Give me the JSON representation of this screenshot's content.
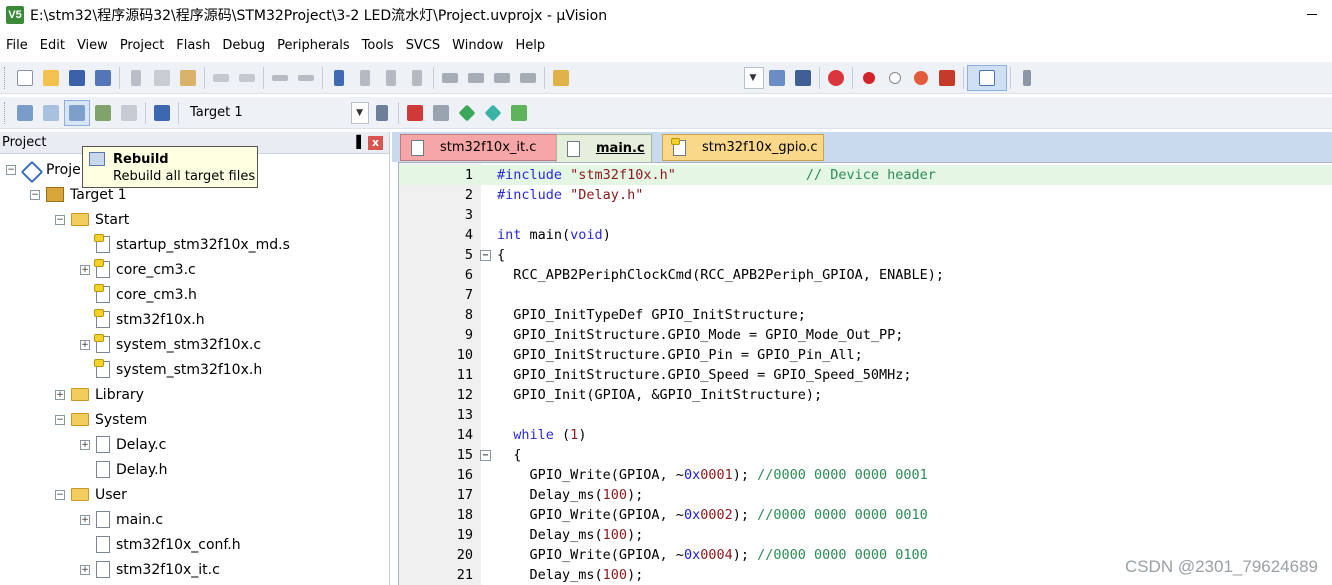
{
  "window": {
    "app_icon_text": "V5",
    "title": "E:\\stm32\\程序源码32\\程序源码\\STM32Project\\3-2 LED流水灯\\Project.uvprojx - µVision"
  },
  "menu": [
    "File",
    "Edit",
    "View",
    "Project",
    "Flash",
    "Debug",
    "Peripherals",
    "Tools",
    "SVCS",
    "Window",
    "Help"
  ],
  "toolbar2": {
    "target": "Target 1"
  },
  "project_panel": {
    "title": "Project",
    "pin": "▐",
    "close": "x",
    "tree": [
      {
        "label": "Proje",
        "depth": 0,
        "icon": "project",
        "exp": "-"
      },
      {
        "label": "Target 1",
        "depth": 1,
        "icon": "target",
        "exp": "-"
      },
      {
        "label": "Start",
        "depth": 2,
        "icon": "folder",
        "exp": "-"
      },
      {
        "label": "startup_stm32f10x_md.s",
        "depth": 3,
        "icon": "file-key",
        "exp": ""
      },
      {
        "label": "core_cm3.c",
        "depth": 3,
        "icon": "file-key",
        "exp": "+"
      },
      {
        "label": "core_cm3.h",
        "depth": 3,
        "icon": "file-key",
        "exp": ""
      },
      {
        "label": "stm32f10x.h",
        "depth": 3,
        "icon": "file-key",
        "exp": ""
      },
      {
        "label": "system_stm32f10x.c",
        "depth": 3,
        "icon": "file-key",
        "exp": "+"
      },
      {
        "label": "system_stm32f10x.h",
        "depth": 3,
        "icon": "file-key",
        "exp": ""
      },
      {
        "label": "Library",
        "depth": 2,
        "icon": "folder",
        "exp": "+"
      },
      {
        "label": "System",
        "depth": 2,
        "icon": "folder",
        "exp": "-"
      },
      {
        "label": "Delay.c",
        "depth": 3,
        "icon": "file",
        "exp": "+"
      },
      {
        "label": "Delay.h",
        "depth": 3,
        "icon": "file",
        "exp": ""
      },
      {
        "label": "User",
        "depth": 2,
        "icon": "folder",
        "exp": "-"
      },
      {
        "label": "main.c",
        "depth": 3,
        "icon": "file",
        "exp": "+"
      },
      {
        "label": "stm32f10x_conf.h",
        "depth": 3,
        "icon": "file",
        "exp": ""
      },
      {
        "label": "stm32f10x_it.c",
        "depth": 3,
        "icon": "file",
        "exp": "+"
      }
    ]
  },
  "tooltip": {
    "title": "Rebuild",
    "description": "Rebuild all target files"
  },
  "tabs": [
    {
      "label": "stm32f10x_it.c"
    },
    {
      "label": "main.c"
    },
    {
      "label": "stm32f10x_gpio.c"
    }
  ],
  "code_lines": [
    {
      "n": "1",
      "fold": "",
      "current": true,
      "segs": [
        [
          "kw",
          "#include"
        ],
        [
          "",
          " "
        ],
        [
          "str",
          "\"stm32f10x.h\""
        ],
        [
          "",
          "                "
        ],
        [
          "cm",
          "// Device header"
        ]
      ]
    },
    {
      "n": "2",
      "fold": "",
      "segs": [
        [
          "kw",
          "#include"
        ],
        [
          "",
          " "
        ],
        [
          "str",
          "\"Delay.h\""
        ]
      ]
    },
    {
      "n": "3",
      "fold": "",
      "segs": []
    },
    {
      "n": "4",
      "fold": "",
      "segs": [
        [
          "kw",
          "int"
        ],
        [
          "",
          " main("
        ],
        [
          "kw",
          "void"
        ],
        [
          "",
          ")"
        ]
      ]
    },
    {
      "n": "5",
      "fold": "-",
      "segs": [
        [
          "",
          "{"
        ]
      ]
    },
    {
      "n": "6",
      "fold": "",
      "segs": [
        [
          "",
          "  RCC_APB2PeriphClockCmd(RCC_APB2Periph_GPIOA, ENABLE);"
        ]
      ]
    },
    {
      "n": "7",
      "fold": "",
      "segs": []
    },
    {
      "n": "8",
      "fold": "",
      "segs": [
        [
          "",
          "  GPIO_InitTypeDef GPIO_InitStructure;"
        ]
      ]
    },
    {
      "n": "9",
      "fold": "",
      "segs": [
        [
          "",
          "  GPIO_InitStructure.GPIO_Mode = GPIO_Mode_Out_PP;"
        ]
      ]
    },
    {
      "n": "10",
      "fold": "",
      "segs": [
        [
          "",
          "  GPIO_InitStructure.GPIO_Pin = GPIO_Pin_All;"
        ]
      ]
    },
    {
      "n": "11",
      "fold": "",
      "segs": [
        [
          "",
          "  GPIO_InitStructure.GPIO_Speed = GPIO_Speed_50MHz;"
        ]
      ]
    },
    {
      "n": "12",
      "fold": "",
      "segs": [
        [
          "",
          "  GPIO_Init(GPIOA, &GPIO_InitStructure);"
        ]
      ]
    },
    {
      "n": "13",
      "fold": "",
      "segs": []
    },
    {
      "n": "14",
      "fold": "",
      "segs": [
        [
          "",
          "  "
        ],
        [
          "kw",
          "while"
        ],
        [
          "",
          " ("
        ],
        [
          "num",
          "1"
        ],
        [
          "",
          ")"
        ]
      ]
    },
    {
      "n": "15",
      "fold": "-",
      "segs": [
        [
          "",
          "  {"
        ]
      ]
    },
    {
      "n": "16",
      "fold": "",
      "segs": [
        [
          "",
          "    GPIO_Write(GPIOA, ~"
        ],
        [
          "hex-pre",
          "0x"
        ],
        [
          "num",
          "0001"
        ],
        [
          "",
          "); "
        ],
        [
          "cm",
          "//0000 0000 0000 0001"
        ]
      ]
    },
    {
      "n": "17",
      "fold": "",
      "segs": [
        [
          "",
          "    Delay_ms("
        ],
        [
          "num",
          "100"
        ],
        [
          "",
          ");"
        ]
      ]
    },
    {
      "n": "18",
      "fold": "",
      "segs": [
        [
          "",
          "    GPIO_Write(GPIOA, ~"
        ],
        [
          "hex-pre",
          "0x"
        ],
        [
          "num",
          "0002"
        ],
        [
          "",
          "); "
        ],
        [
          "cm",
          "//0000 0000 0000 0010"
        ]
      ]
    },
    {
      "n": "19",
      "fold": "",
      "segs": [
        [
          "",
          "    Delay_ms("
        ],
        [
          "num",
          "100"
        ],
        [
          "",
          ");"
        ]
      ]
    },
    {
      "n": "20",
      "fold": "",
      "segs": [
        [
          "",
          "    GPIO_Write(GPIOA, ~"
        ],
        [
          "hex-pre",
          "0x"
        ],
        [
          "num",
          "0004"
        ],
        [
          "",
          "); "
        ],
        [
          "cm",
          "//0000 0000 0000 0100"
        ]
      ]
    },
    {
      "n": "21",
      "fold": "",
      "segs": [
        [
          "",
          "    Delay_ms("
        ],
        [
          "num",
          "100"
        ],
        [
          "",
          ");"
        ]
      ]
    }
  ],
  "watermark": "CSDN @2301_79624689"
}
